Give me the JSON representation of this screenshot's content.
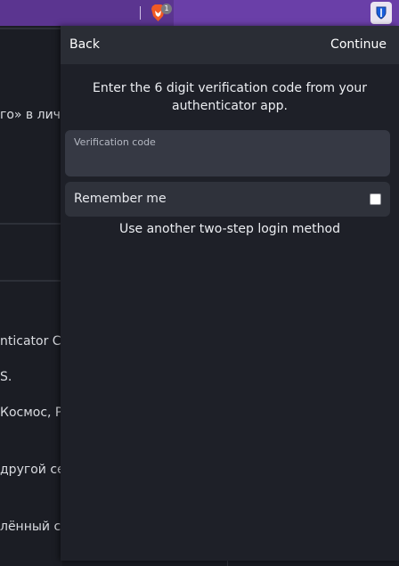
{
  "browser": {
    "badge_count": "1",
    "extension_icon": "shield-icon",
    "brave_icon": "brave-lion-icon"
  },
  "background": {
    "lines": [
      "го» в личн",
      "nticator C",
      "S.",
      "Космос, Р",
      "другой се",
      "лённый се"
    ]
  },
  "popup": {
    "back_label": "Back",
    "continue_label": "Continue",
    "instructions": "Enter the 6 digit verification code from your authenticator app.",
    "code_field": {
      "label": "Verification code",
      "value": ""
    },
    "remember_label": "Remember me",
    "remember_checked": false,
    "alt_method_label": "Use another two-step login method"
  },
  "colors": {
    "browser_bar": "#6a3fa8",
    "popup_bg": "#1e2028",
    "header_bg": "#2a2d35",
    "field_bg": "#363944"
  }
}
